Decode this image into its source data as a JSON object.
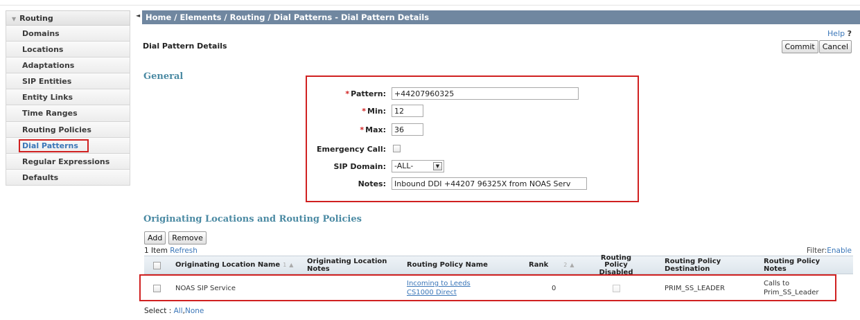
{
  "sidebar": {
    "header": "Routing",
    "items": [
      {
        "label": "Domains"
      },
      {
        "label": "Locations"
      },
      {
        "label": "Adaptations"
      },
      {
        "label": "SIP Entities"
      },
      {
        "label": "Entity Links"
      },
      {
        "label": "Time Ranges"
      },
      {
        "label": "Routing Policies"
      },
      {
        "label": "Dial Patterns"
      },
      {
        "label": "Regular Expressions"
      },
      {
        "label": "Defaults"
      }
    ]
  },
  "breadcrumb": "Home / Elements / Routing / Dial Patterns - Dial Pattern Details",
  "help": {
    "label": "Help",
    "mark": "?"
  },
  "page_title": "Dial Pattern Details",
  "buttons": {
    "commit": "Commit",
    "cancel": "Cancel",
    "add": "Add",
    "remove": "Remove"
  },
  "general": {
    "title": "General",
    "pattern_label": "Pattern:",
    "pattern_value": "+44207960325",
    "min_label": "Min:",
    "min_value": "12",
    "max_label": "Max:",
    "max_value": "36",
    "required_mark": "*",
    "emergency_label": "Emergency Call:",
    "sip_domain_label": "SIP Domain:",
    "sip_domain_value": "-ALL-",
    "notes_label": "Notes:",
    "notes_value": "Inbound DDI +44207 96325X from NOAS Serv"
  },
  "origin": {
    "title": "Originating Locations and Routing Policies",
    "items_count": "1 Item",
    "refresh": "Refresh",
    "filter_label": "Filter:",
    "filter_link": "Enable",
    "columns": {
      "location_name": "Originating Location Name",
      "location_name_sort": "1",
      "location_notes": "Originating Location Notes",
      "policy_name": "Routing Policy Name",
      "rank": "Rank",
      "rank_sort": "2",
      "disabled": "Routing Policy Disabled",
      "destination": "Routing Policy Destination",
      "policy_notes": "Routing Policy Notes"
    },
    "rows": [
      {
        "location_name": "NOAS SIP Service",
        "location_notes": "",
        "policy_name": "Incoming to Leeds CS1000 Direct",
        "rank": "0",
        "disabled": false,
        "destination": "PRIM_SS_LEADER",
        "notes": "Calls to Prim_SS_Leader"
      }
    ],
    "select_label": "Select :",
    "select_all": "All",
    "select_none": "None"
  },
  "colors": {
    "accent": "#3a76b8",
    "breadcrumb_bg": "#7087a0",
    "highlight": "#d02020",
    "section": "#4b8aa3"
  }
}
